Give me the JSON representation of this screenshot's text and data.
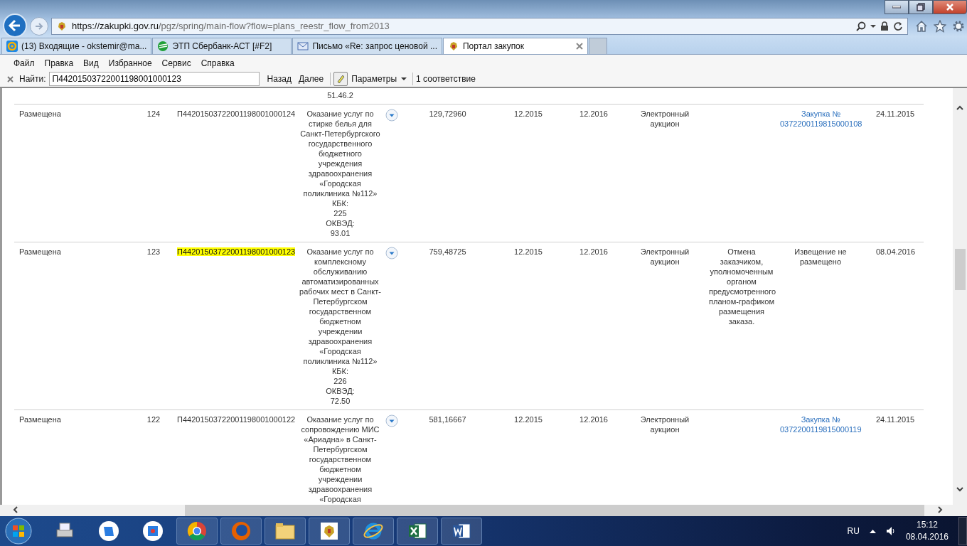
{
  "address_bar": {
    "url_host": "https://zakupki.gov.ru",
    "url_path": "/pgz/spring/main-flow?flow=plans_reestr_flow_from2013"
  },
  "tabs": [
    {
      "title": "(13) Входящие - okstemir@ma...",
      "selected": false
    },
    {
      "title": "ЭТП Сбербанк-АСТ [#F2]",
      "selected": false
    },
    {
      "title": "Письмо «Re: запрос ценовой ...",
      "selected": false
    },
    {
      "title": "Портал закупок",
      "selected": true
    }
  ],
  "menu": [
    "Файл",
    "Правка",
    "Вид",
    "Избранное",
    "Сервис",
    "Справка"
  ],
  "find_bar": {
    "label": "Найти:",
    "value": "П44201503722001198001000123",
    "prev": "Назад",
    "next": "Далее",
    "options": "Параметры",
    "result": "1 соответствие"
  },
  "table": {
    "rows": [
      {
        "okved": "51.46.2"
      },
      {
        "status": "Размещена",
        "number": "124",
        "code": "П44201503722001198001000124",
        "highlighted": false,
        "description": "Оказание услуг по стирке белья для Санкт-Петербургского государственного бюджетного учреждения здравоохранения «Городская поликлиника №112»",
        "kbk_label": "КБК:",
        "kbk": "225",
        "okved_label": "ОКВЭД:",
        "okved": "93.01",
        "price": "129,72960",
        "start": "12.2015",
        "end": "12.2016",
        "method": "Электронный аукцион",
        "purchase": {
          "kind": "link",
          "text": "Закупка № 0372200119815000108"
        },
        "date": "24.11.2015"
      },
      {
        "status": "Размещена",
        "number": "123",
        "code": "П44201503722001198001000123",
        "highlighted": true,
        "description": "Оказание услуг по комплексному обслуживанию автоматизированных рабочих мест в Санкт-Петербургском государственном бюджетном учреждении здравоохранения «Городская поликлиника №112»",
        "kbk_label": "КБК:",
        "kbk": "226",
        "okved_label": "ОКВЭД:",
        "okved": "72.50",
        "price": "759,48725",
        "start": "12.2015",
        "end": "12.2016",
        "method": "Электронный аукцион",
        "note": "Отмена заказчиком, уполномоченным органом предусмотренного планом-графиком размещения заказа.",
        "purchase": {
          "kind": "text",
          "text": "Извещение не размещено"
        },
        "date": "08.04.2016"
      },
      {
        "status": "Размещена",
        "number": "122",
        "code": "П44201503722001198001000122",
        "highlighted": false,
        "description": "Оказание услуг по сопровождению МИС «Ариадна» в Санкт-Петербургском государственном бюджетном учреждении здравоохранения «Городская",
        "price": "581,16667",
        "start": "12.2015",
        "end": "12.2016",
        "method": "Электронный аукцион",
        "purchase": {
          "kind": "link",
          "text": "Закупка № 0372200119815000119"
        },
        "date": "24.11.2015"
      }
    ]
  },
  "taskbar": {
    "lang": "RU",
    "time": "15:12",
    "date": "08.04.2016"
  }
}
